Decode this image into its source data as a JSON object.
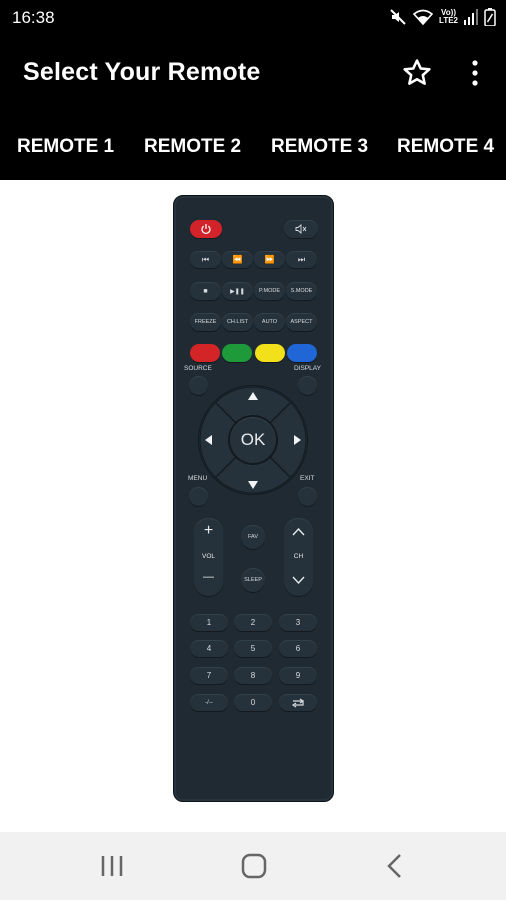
{
  "status_bar": {
    "time": "16:38",
    "icons": [
      "mute-icon",
      "wifi-icon",
      "volte-icon",
      "signal-icon",
      "battery-icon"
    ],
    "volte_text": [
      "Vo))",
      "LTE2"
    ]
  },
  "app_bar": {
    "title": "Select Your Remote",
    "actions": [
      "star-icon",
      "more-vert-icon"
    ]
  },
  "tabs": [
    {
      "label": "REMOTE 1"
    },
    {
      "label": "REMOTE 2"
    },
    {
      "label": "REMOTE 3"
    },
    {
      "label": "REMOTE 4"
    }
  ],
  "remote": {
    "transport_row1": [
      "⏮",
      "⏪",
      "⏩",
      "⏭"
    ],
    "row2": {
      "stop": "■",
      "play_pause": "▶❚❚",
      "pmode": "P.MODE",
      "smode": "S.MODE"
    },
    "row3": [
      "FREEZE",
      "CH.LIST",
      "AUTO",
      "ASPECT"
    ],
    "colors": [
      "#d32528",
      "#1e9a3a",
      "#f2e01a",
      "#2166d6"
    ],
    "source": "SOURCE",
    "display": "DISPLAY",
    "ok": "OK",
    "menu": "MENU",
    "exit": "EXIT",
    "vol": {
      "plus": "+",
      "label": "VOL",
      "minus": "—"
    },
    "fav": "FAV",
    "sleep": "SLEEP",
    "ch": {
      "label": "CH"
    },
    "numbers": [
      [
        "1",
        "2",
        "3"
      ],
      [
        "4",
        "5",
        "6"
      ],
      [
        "7",
        "8",
        "9"
      ],
      [
        "-/--",
        "0",
        ""
      ]
    ]
  },
  "nav_bar": {
    "icons": [
      "recents-icon",
      "home-icon",
      "back-icon"
    ]
  }
}
